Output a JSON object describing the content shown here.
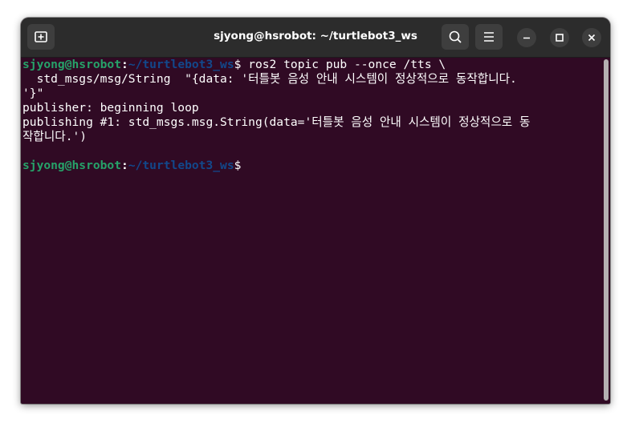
{
  "window": {
    "title": "sjyong@hsrobot: ~/turtlebot3_ws"
  },
  "titlebar": {
    "new_tab_icon": "new-tab-icon",
    "search_icon": "search-icon",
    "menu_icon": "hamburger-menu-icon",
    "minimize_icon": "minimize-icon",
    "maximize_icon": "maximize-icon",
    "close_icon": "close-icon"
  },
  "terminal": {
    "prompt_user": "sjyong@hsrobot",
    "prompt_colon": ":",
    "prompt_path": "~/turtlebot3_ws",
    "prompt_dollar": "$",
    "command_1": " ros2 topic pub --once /tts \\",
    "command_2": "  std_msgs/msg/String  \"{data: '터틀봇 음성 안내 시스템이 정상적으로 동작합니다.",
    "command_3": "'}\"",
    "output_1": "publisher: beginning loop",
    "output_2": "publishing #1: std_msgs.msg.String(data='터틀봇 음성 안내 시스템이 정상적으로 동",
    "output_3": "작합니다.')",
    "prompt2_user": "sjyong@hsrobot",
    "prompt2_colon": ":",
    "prompt2_path": "~/turtlebot3_ws",
    "prompt2_dollar": "$"
  },
  "colors": {
    "terminal_bg": "#300a24",
    "titlebar_bg": "#2c2c2c",
    "prompt_user": "#26a269",
    "prompt_path": "#12488b",
    "text": "#ffffff"
  }
}
